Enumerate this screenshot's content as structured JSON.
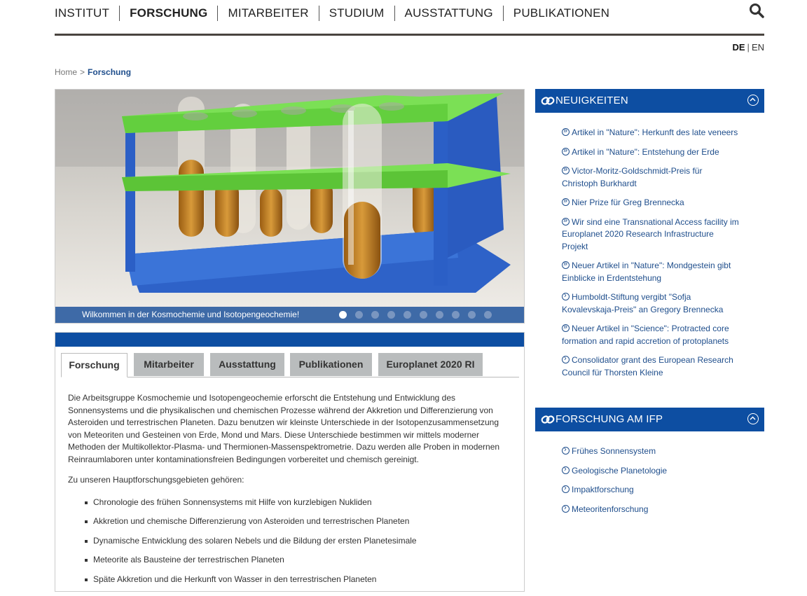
{
  "nav": {
    "items": [
      "INSTITUT",
      "FORSCHUNG",
      "MITARBEITER",
      "STUDIUM",
      "AUSSTATTUNG",
      "PUBLIKATIONEN"
    ],
    "active": "FORSCHUNG"
  },
  "lang": {
    "de": "DE",
    "sep": "|",
    "en": "EN"
  },
  "breadcrumb": {
    "home": "Home",
    "sep": ">",
    "current": "Forschung"
  },
  "slider": {
    "caption": "Wilkommen in der Kosmochemie und Isotopengeochemie!",
    "dot_count": 10,
    "active_dot": 1
  },
  "tabs": [
    "Forschung",
    "Mitarbeiter",
    "Ausstattung",
    "Publikationen",
    "Europlanet 2020 RI"
  ],
  "content": {
    "paragraph": "Die Arbeitsgruppe Kosmochemie und Isotopengeochemie erforscht die Entstehung und Entwicklung des Sonnensystems und die physikalischen und chemischen Prozesse während der Akkretion und Differenzierung von Asteroiden und terrestrischen Planeten. Dazu benutzen wir kleinste Unterschiede in der Isotopenzusammensetzung von Meteoriten und Gesteinen von Erde, Mond und Mars. Diese Unterschiede bestimmen wir mittels moderner Methoden der Multikollektor-Plasma- und Thermionen-Massenspektrometrie. Dazu werden alle Proben in modernen Reinraumlaboren unter kontaminationsfreien Bedingungen vorbereitet und chemisch gereinigt.",
    "intro": "Zu unseren Hauptforschungsgebieten gehören:",
    "list": [
      "Chronologie des frühen Sonnensystems mit Hilfe von kurzlebigen Nukliden",
      "Akkretion und chemische Differenzierung von Asteroiden und terrestrischen Planeten",
      "Dynamische Entwicklung des solaren Nebels und die Bildung der ersten Planetesimale",
      "Meteorite als Bausteine der terrestrischen Planeten",
      "Späte Akkretion und die Herkunft von Wasser in den terrestrischen Planeten"
    ]
  },
  "news": {
    "title": "NEUIGKEITEN",
    "items": [
      "Artikel in \"Nature\": Herkunft des late veneers",
      "Artikel in \"Nature\": Entstehung der Erde",
      "Victor-Moritz-Goldschmidt-Preis für Christoph Burkhardt",
      "Nier Prize für Greg Brennecka",
      "Wir sind eine Transnational Access facility im Europlanet 2020 Research Infrastructure Projekt",
      "Neuer Artikel in \"Nature\": Mondgestein gibt Einblicke in Erdentstehung",
      "Humboldt-Stiftung vergibt \"Sofja Kovalevskaja-Preis\" an Gregory Brennecka",
      "Neuer Artikel in \"Science\": Protracted core formation and rapid accretion of protoplanets",
      "Consolidator grant des European Research Council für Thorsten Kleine"
    ]
  },
  "research": {
    "title": "FORSCHUNG AM IFP",
    "items": [
      "Frühes Sonnensystem",
      "Geologische Planetologie",
      "Impaktforschung",
      "Meteoritenforschung"
    ]
  },
  "colors": {
    "brand_blue": "#0d4ea2",
    "caption_blue": "#3e6aa7",
    "link_blue": "#1f4e8c",
    "tab_grey": "#b9bcbd"
  }
}
